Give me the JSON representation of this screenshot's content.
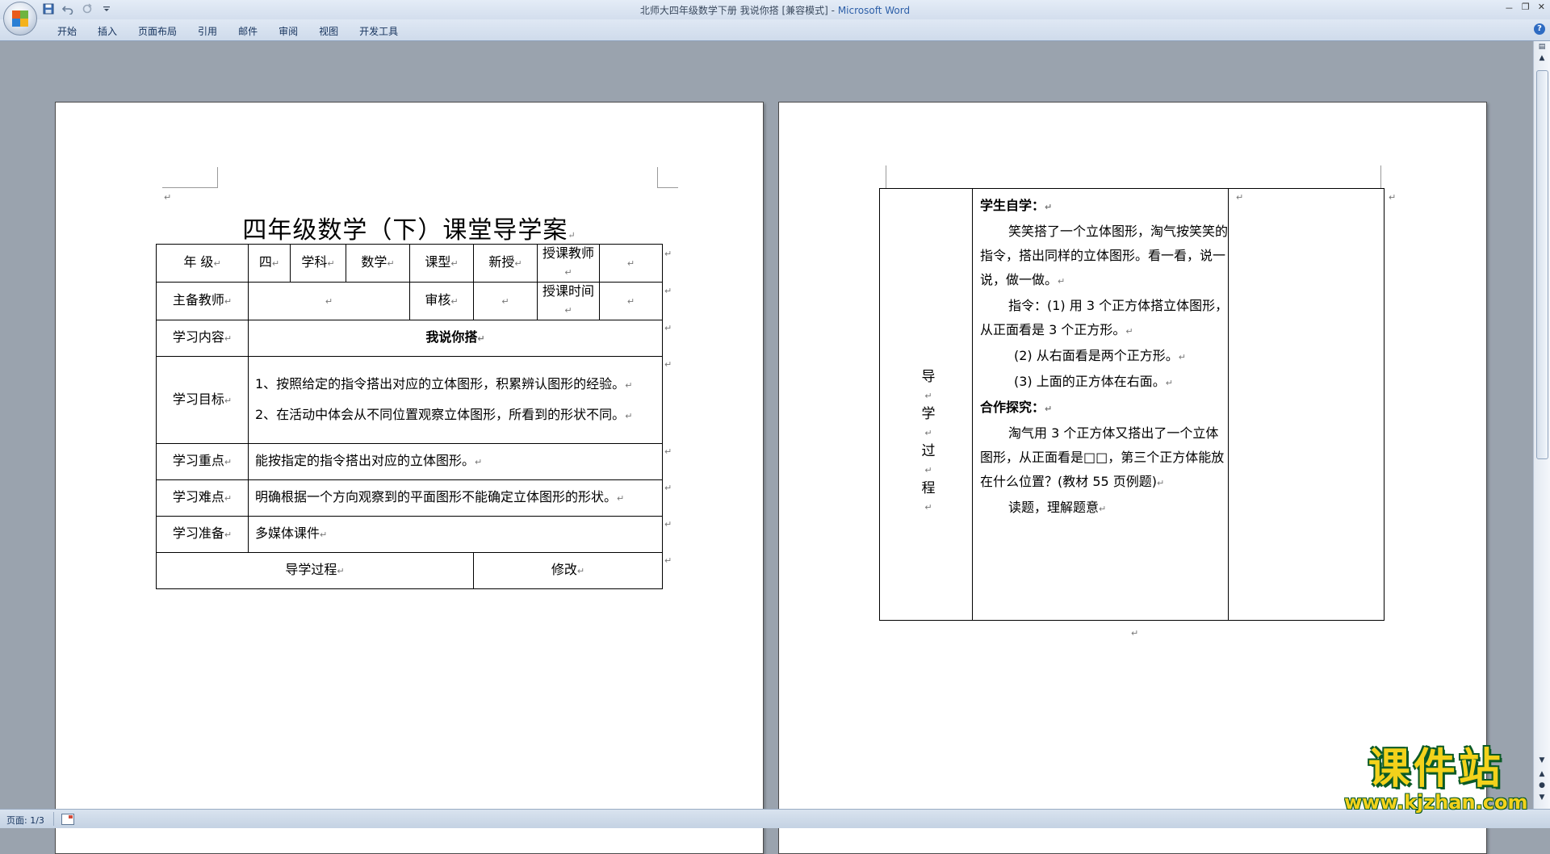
{
  "window": {
    "title_doc": "北师大四年级数学下册 我说你搭 [兼容模式] - ",
    "title_app": "Microsoft Word",
    "minimize": "－",
    "restore": "❐",
    "close": "✕"
  },
  "ribbon": {
    "tabs": [
      "开始",
      "插入",
      "页面布局",
      "引用",
      "邮件",
      "审阅",
      "视图",
      "开发工具"
    ],
    "help": "?"
  },
  "status": {
    "page_indicator": "页面: 1/3"
  },
  "para_mark": "↵",
  "page1": {
    "title": "四年级数学（下）课堂导学案",
    "table": {
      "row1": [
        "年  级",
        "四",
        "学科",
        "数学",
        "课型",
        "新授",
        "授课教师",
        ""
      ],
      "row2": [
        "主备教师",
        "",
        "审核",
        "",
        "授课时间",
        ""
      ],
      "content_label": "学习内容",
      "content_value": "我说你搭",
      "goal_label": "学习目标",
      "goals": [
        "1、按照给定的指令搭出对应的立体图形，积累辨认图形的经验。",
        "2、在活动中体会从不同位置观察立体图形，所看到的形状不同。"
      ],
      "key_label": "学习重点",
      "key_value": "能按指定的指令搭出对应的立体图形。",
      "difficulty_label": "学习难点",
      "difficulty_value": "明确根据一个方向观察到的平面图形不能确定立体图形的形状。",
      "prep_label": "学习准备",
      "prep_value": "多媒体课件",
      "process_label": "导学过程",
      "revise_label": "修改"
    }
  },
  "page2": {
    "column_label": [
      "导",
      "学",
      "过",
      "程"
    ],
    "self_study_head": "学生自学：",
    "self_study_text": "笑笑搭了一个立体图形，淘气按笑笑的指令，搭出同样的立体图形。看一看，说一说，做一做。",
    "instruction_1": "指令：(1) 用 3 个正方体搭立体图形，从正面看是 3 个正方形。",
    "instruction_2": "(2) 从右面看是两个正方形。",
    "instruction_3": "(3) 上面的正方体在右面。",
    "coop_head": "合作探究：",
    "coop_text": "淘气用 3 个正方体又搭出了一个立体图形，从正面看是□□，第三个正方体能放在什么位置？(教材 55 页例题)",
    "read_text": "读题，理解题意"
  },
  "watermark": {
    "title": "课件站",
    "url": "www.kjzhan.com"
  }
}
